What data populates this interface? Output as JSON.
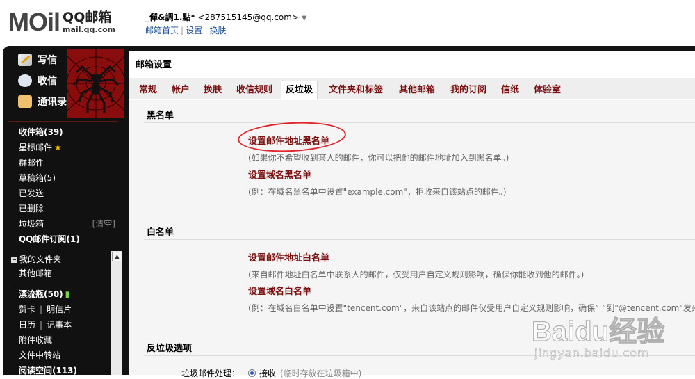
{
  "header": {
    "logo_text": "MOil",
    "brand_name": "QQ邮箱",
    "brand_url": "mail.qq.com",
    "nickname": "_僤&調1.點*",
    "email": "<287515145@qq.com>",
    "links": [
      "邮箱首页",
      "设置",
      "换肤"
    ],
    "link_sep": "|",
    "link_sep2": "-"
  },
  "sidebar": {
    "write": "写信",
    "receive": "收信",
    "contacts": "通讯录",
    "folders": [
      {
        "label": "收件箱(39)",
        "bold": true
      },
      {
        "label": "星标邮件",
        "bold": false
      },
      {
        "label": "群邮件",
        "bold": false
      },
      {
        "label": "草稿箱(5)",
        "bold": false
      },
      {
        "label": "已发送",
        "bold": false
      },
      {
        "label": "已删除",
        "bold": false
      },
      {
        "label": "垃圾箱",
        "bold": false
      },
      {
        "label": "QQ邮件订阅(1)",
        "bold": true
      }
    ],
    "clear_label": "[清空]",
    "my_folders": "我的文件夹",
    "other_mailboxes": "其他邮箱",
    "drift_bottle": "漂流瓶(50)",
    "card": "贺卡",
    "postcard": "明信片",
    "calendar": "日历",
    "notepad": "记事本",
    "attachments": "附件收藏",
    "file_transfer": "文件中转站",
    "reading_space": "阅读空间(113)",
    "pipe": "|"
  },
  "main": {
    "title": "邮箱设置",
    "tabs": [
      "常规",
      "帐户",
      "换肤",
      "收信规则",
      "反垃圾",
      "文件夹和标签",
      "其他邮箱",
      "我的订阅",
      "信纸",
      "体验室"
    ],
    "active_tab": "反垃圾",
    "blacklist": {
      "title": "黑名单",
      "addr_link": "设置邮件地址黑名单",
      "addr_hint": "(如果你不希望收到某人的邮件，你可以把他的邮件地址加入到黑名单。)",
      "domain_link": "设置域名黑名单",
      "domain_hint": "(例：在域名黑名单中设置\"example.com\"，拒收来自该站点的邮件。)"
    },
    "whitelist": {
      "title": "白名单",
      "addr_link": "设置邮件地址白名单",
      "addr_hint": "(来自邮件地址白名单中联系人的邮件，仅受用户自定义规则影响，确保你能收到他的邮件。)",
      "domain_link": "设置域名白名单",
      "domain_hint": "(例：在域名白名单中设置\"tencent.com\"，来自该站点的邮件仅受用户自定义规则影响，确保“ ”到\"@tencent.com\"发来"
    },
    "antispam": {
      "title": "反垃圾选项",
      "label": "垃圾邮件处理：",
      "option": "接收",
      "option_hint": "(临时存放在垃圾箱中)"
    }
  },
  "watermark": {
    "logo": "Baidu经验",
    "url": "jingyan.baidu.com"
  },
  "colors": {
    "frame": "#111111",
    "link": "#7a1010",
    "tabbar": "#eeeeee",
    "highlight_circle": "#e0282e"
  }
}
